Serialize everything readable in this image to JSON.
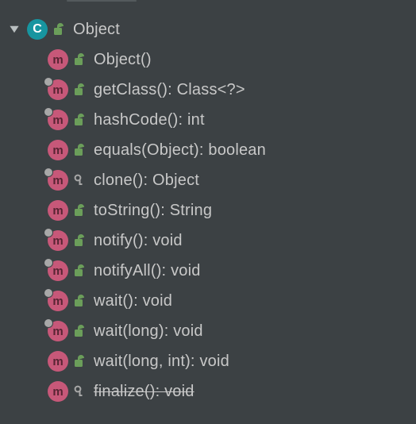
{
  "icons": {
    "class_letter": "C",
    "method_letter": "m"
  },
  "root": {
    "label": "Object",
    "visibility": "public"
  },
  "members": [
    {
      "label": "Object()",
      "visibility": "public",
      "native": false,
      "deprecated": false
    },
    {
      "label": "getClass(): Class<?>",
      "visibility": "public",
      "native": true,
      "deprecated": false
    },
    {
      "label": "hashCode(): int",
      "visibility": "public",
      "native": true,
      "deprecated": false
    },
    {
      "label": "equals(Object): boolean",
      "visibility": "public",
      "native": false,
      "deprecated": false
    },
    {
      "label": "clone(): Object",
      "visibility": "protected",
      "native": true,
      "deprecated": false
    },
    {
      "label": "toString(): String",
      "visibility": "public",
      "native": false,
      "deprecated": false
    },
    {
      "label": "notify(): void",
      "visibility": "public",
      "native": true,
      "deprecated": false
    },
    {
      "label": "notifyAll(): void",
      "visibility": "public",
      "native": true,
      "deprecated": false
    },
    {
      "label": "wait(): void",
      "visibility": "public",
      "native": true,
      "deprecated": false
    },
    {
      "label": "wait(long): void",
      "visibility": "public",
      "native": true,
      "deprecated": false
    },
    {
      "label": "wait(long, int): void",
      "visibility": "public",
      "native": false,
      "deprecated": false
    },
    {
      "label": "finalize(): void",
      "visibility": "protected",
      "native": false,
      "deprecated": true
    }
  ]
}
